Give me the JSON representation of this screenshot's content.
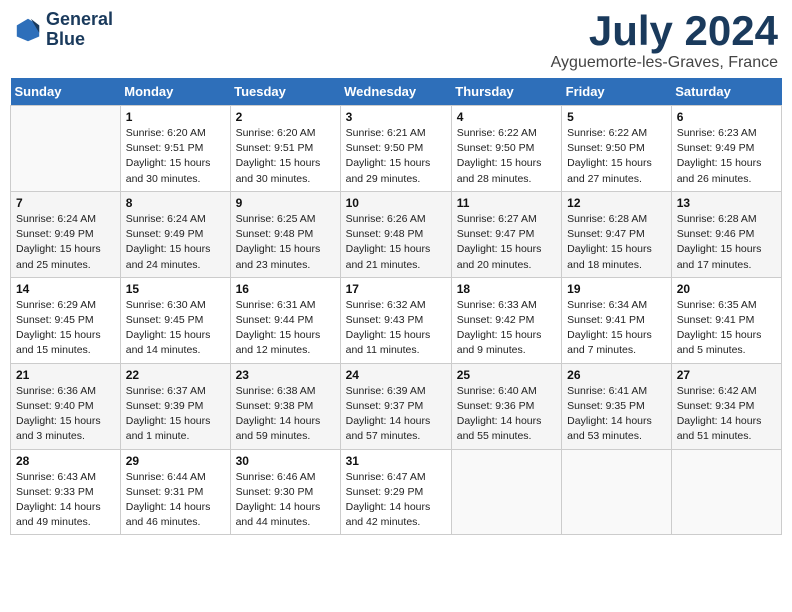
{
  "logo": {
    "line1": "General",
    "line2": "Blue"
  },
  "title": "July 2024",
  "location": "Ayguemorte-les-Graves, France",
  "days_header": [
    "Sunday",
    "Monday",
    "Tuesday",
    "Wednesday",
    "Thursday",
    "Friday",
    "Saturday"
  ],
  "weeks": [
    [
      {
        "num": "",
        "info": ""
      },
      {
        "num": "1",
        "info": "Sunrise: 6:20 AM\nSunset: 9:51 PM\nDaylight: 15 hours\nand 30 minutes."
      },
      {
        "num": "2",
        "info": "Sunrise: 6:20 AM\nSunset: 9:51 PM\nDaylight: 15 hours\nand 30 minutes."
      },
      {
        "num": "3",
        "info": "Sunrise: 6:21 AM\nSunset: 9:50 PM\nDaylight: 15 hours\nand 29 minutes."
      },
      {
        "num": "4",
        "info": "Sunrise: 6:22 AM\nSunset: 9:50 PM\nDaylight: 15 hours\nand 28 minutes."
      },
      {
        "num": "5",
        "info": "Sunrise: 6:22 AM\nSunset: 9:50 PM\nDaylight: 15 hours\nand 27 minutes."
      },
      {
        "num": "6",
        "info": "Sunrise: 6:23 AM\nSunset: 9:49 PM\nDaylight: 15 hours\nand 26 minutes."
      }
    ],
    [
      {
        "num": "7",
        "info": "Sunrise: 6:24 AM\nSunset: 9:49 PM\nDaylight: 15 hours\nand 25 minutes."
      },
      {
        "num": "8",
        "info": "Sunrise: 6:24 AM\nSunset: 9:49 PM\nDaylight: 15 hours\nand 24 minutes."
      },
      {
        "num": "9",
        "info": "Sunrise: 6:25 AM\nSunset: 9:48 PM\nDaylight: 15 hours\nand 23 minutes."
      },
      {
        "num": "10",
        "info": "Sunrise: 6:26 AM\nSunset: 9:48 PM\nDaylight: 15 hours\nand 21 minutes."
      },
      {
        "num": "11",
        "info": "Sunrise: 6:27 AM\nSunset: 9:47 PM\nDaylight: 15 hours\nand 20 minutes."
      },
      {
        "num": "12",
        "info": "Sunrise: 6:28 AM\nSunset: 9:47 PM\nDaylight: 15 hours\nand 18 minutes."
      },
      {
        "num": "13",
        "info": "Sunrise: 6:28 AM\nSunset: 9:46 PM\nDaylight: 15 hours\nand 17 minutes."
      }
    ],
    [
      {
        "num": "14",
        "info": "Sunrise: 6:29 AM\nSunset: 9:45 PM\nDaylight: 15 hours\nand 15 minutes."
      },
      {
        "num": "15",
        "info": "Sunrise: 6:30 AM\nSunset: 9:45 PM\nDaylight: 15 hours\nand 14 minutes."
      },
      {
        "num": "16",
        "info": "Sunrise: 6:31 AM\nSunset: 9:44 PM\nDaylight: 15 hours\nand 12 minutes."
      },
      {
        "num": "17",
        "info": "Sunrise: 6:32 AM\nSunset: 9:43 PM\nDaylight: 15 hours\nand 11 minutes."
      },
      {
        "num": "18",
        "info": "Sunrise: 6:33 AM\nSunset: 9:42 PM\nDaylight: 15 hours\nand 9 minutes."
      },
      {
        "num": "19",
        "info": "Sunrise: 6:34 AM\nSunset: 9:41 PM\nDaylight: 15 hours\nand 7 minutes."
      },
      {
        "num": "20",
        "info": "Sunrise: 6:35 AM\nSunset: 9:41 PM\nDaylight: 15 hours\nand 5 minutes."
      }
    ],
    [
      {
        "num": "21",
        "info": "Sunrise: 6:36 AM\nSunset: 9:40 PM\nDaylight: 15 hours\nand 3 minutes."
      },
      {
        "num": "22",
        "info": "Sunrise: 6:37 AM\nSunset: 9:39 PM\nDaylight: 15 hours\nand 1 minute."
      },
      {
        "num": "23",
        "info": "Sunrise: 6:38 AM\nSunset: 9:38 PM\nDaylight: 14 hours\nand 59 minutes."
      },
      {
        "num": "24",
        "info": "Sunrise: 6:39 AM\nSunset: 9:37 PM\nDaylight: 14 hours\nand 57 minutes."
      },
      {
        "num": "25",
        "info": "Sunrise: 6:40 AM\nSunset: 9:36 PM\nDaylight: 14 hours\nand 55 minutes."
      },
      {
        "num": "26",
        "info": "Sunrise: 6:41 AM\nSunset: 9:35 PM\nDaylight: 14 hours\nand 53 minutes."
      },
      {
        "num": "27",
        "info": "Sunrise: 6:42 AM\nSunset: 9:34 PM\nDaylight: 14 hours\nand 51 minutes."
      }
    ],
    [
      {
        "num": "28",
        "info": "Sunrise: 6:43 AM\nSunset: 9:33 PM\nDaylight: 14 hours\nand 49 minutes."
      },
      {
        "num": "29",
        "info": "Sunrise: 6:44 AM\nSunset: 9:31 PM\nDaylight: 14 hours\nand 46 minutes."
      },
      {
        "num": "30",
        "info": "Sunrise: 6:46 AM\nSunset: 9:30 PM\nDaylight: 14 hours\nand 44 minutes."
      },
      {
        "num": "31",
        "info": "Sunrise: 6:47 AM\nSunset: 9:29 PM\nDaylight: 14 hours\nand 42 minutes."
      },
      {
        "num": "",
        "info": ""
      },
      {
        "num": "",
        "info": ""
      },
      {
        "num": "",
        "info": ""
      }
    ]
  ]
}
